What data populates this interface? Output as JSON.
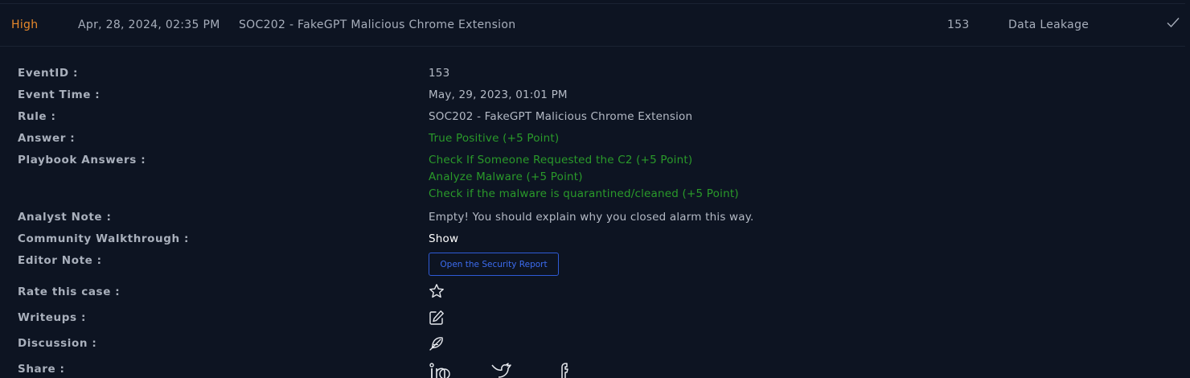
{
  "header": {
    "severity": "High",
    "date": "Apr, 28, 2024, 02:35 PM",
    "rule": "SOC202 - FakeGPT Malicious Chrome Extension",
    "event_id": "153",
    "type": "Data Leakage"
  },
  "details": {
    "event_id_label": "EventID :",
    "event_id_value": "153",
    "event_time_label": "Event Time :",
    "event_time_value": "May, 29, 2023, 01:01 PM",
    "rule_label": "Rule :",
    "rule_value": "SOC202 - FakeGPT Malicious Chrome Extension",
    "answer_label": "Answer :",
    "answer_value": "True Positive (+5 Point)",
    "playbook_label": "Playbook Answers :",
    "playbook_answers": [
      "Check If Someone Requested the C2 (+5 Point)",
      "Analyze Malware (+5 Point)",
      "Check if the malware is quarantined/cleaned (+5 Point)"
    ],
    "analyst_note_label": "Analyst Note :",
    "analyst_note_value": "Empty! You should explain why you closed alarm this way.",
    "walkthrough_label": "Community Walkthrough :",
    "walkthrough_value": "Show",
    "editor_note_label": "Editor Note :",
    "report_button": "Open the Security Report",
    "rate_label": "Rate this case :",
    "writeups_label": "Writeups :",
    "discussion_label": "Discussion :",
    "share_label": "Share :"
  },
  "icons": {
    "check": "check-icon",
    "rate": "star-icon",
    "writeups": "edit-icon",
    "discussion": "feather-icon",
    "share": [
      "linkedin-icon",
      "twitter-icon",
      "social-icon"
    ]
  },
  "colors": {
    "severity_high": "#e8892b",
    "correct_answer": "#2a9a2a",
    "report_button": "#2f5bd6",
    "background": "#0d1422"
  }
}
